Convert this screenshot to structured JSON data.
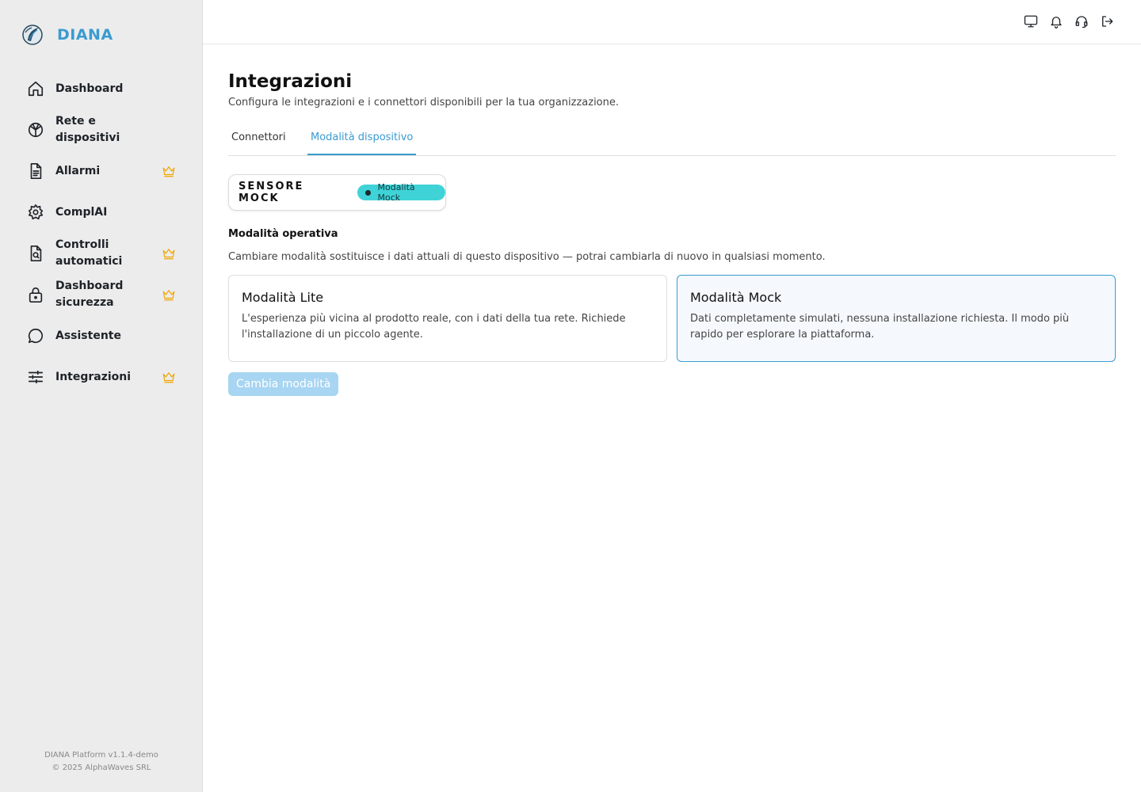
{
  "brand": {
    "name": "DIANA"
  },
  "sidebar": {
    "items": [
      {
        "label": "Dashboard",
        "icon": "home-icon",
        "premium": false
      },
      {
        "label": "Rete e dispositivi",
        "icon": "network-icon",
        "premium": false
      },
      {
        "label": "Allarmi",
        "icon": "document-icon",
        "premium": true
      },
      {
        "label": "ComplAI",
        "icon": "gear-icon",
        "premium": false
      },
      {
        "label": "Controlli automatici",
        "icon": "file-search-icon",
        "premium": true
      },
      {
        "label": "Dashboard sicurezza",
        "icon": "lock-icon",
        "premium": true
      },
      {
        "label": "Assistente",
        "icon": "chat-icon",
        "premium": false
      },
      {
        "label": "Integrazioni",
        "icon": "sliders-icon",
        "premium": true
      }
    ],
    "footer": {
      "version": "DIANA Platform v1.1.4-demo",
      "copyright": "© 2025 AlphaWaves SRL"
    }
  },
  "topbar": {
    "icons": [
      "monitor-icon",
      "bell-icon",
      "headset-icon",
      "logout-icon"
    ]
  },
  "page": {
    "title": "Integrazioni",
    "subtitle": "Configura le integrazioni e i connettori disponibili per la tua organizzazione.",
    "tabs": [
      {
        "label": "Connettori",
        "active": false
      },
      {
        "label": "Modalità dispositivo",
        "active": true
      }
    ]
  },
  "sensor": {
    "name": "SENSORE MOCK",
    "badge": "Modalità Mock"
  },
  "mode_section": {
    "title": "Modalità operativa",
    "description": "Cambiare modalità sostituisce i dati attuali di questo dispositivo — potrai cambiarla di nuovo in qualsiasi momento.",
    "options": [
      {
        "title": "Modalità Lite",
        "description": "L'esperienza più vicina al prodotto reale, con i dati della tua rete. Richiede l'installazione di un piccolo agente.",
        "selected": false
      },
      {
        "title": "Modalità Mock",
        "description": "Dati completamente simulati, nessuna installazione richiesta. Il modo più rapido per esplorare la piattaforma.",
        "selected": true
      }
    ],
    "button_label": "Cambia modalità"
  },
  "colors": {
    "accent": "#3a9bd1",
    "premium": "#f0a500",
    "badge": "#3fd3d8",
    "button_disabled": "#a7d5f2"
  }
}
